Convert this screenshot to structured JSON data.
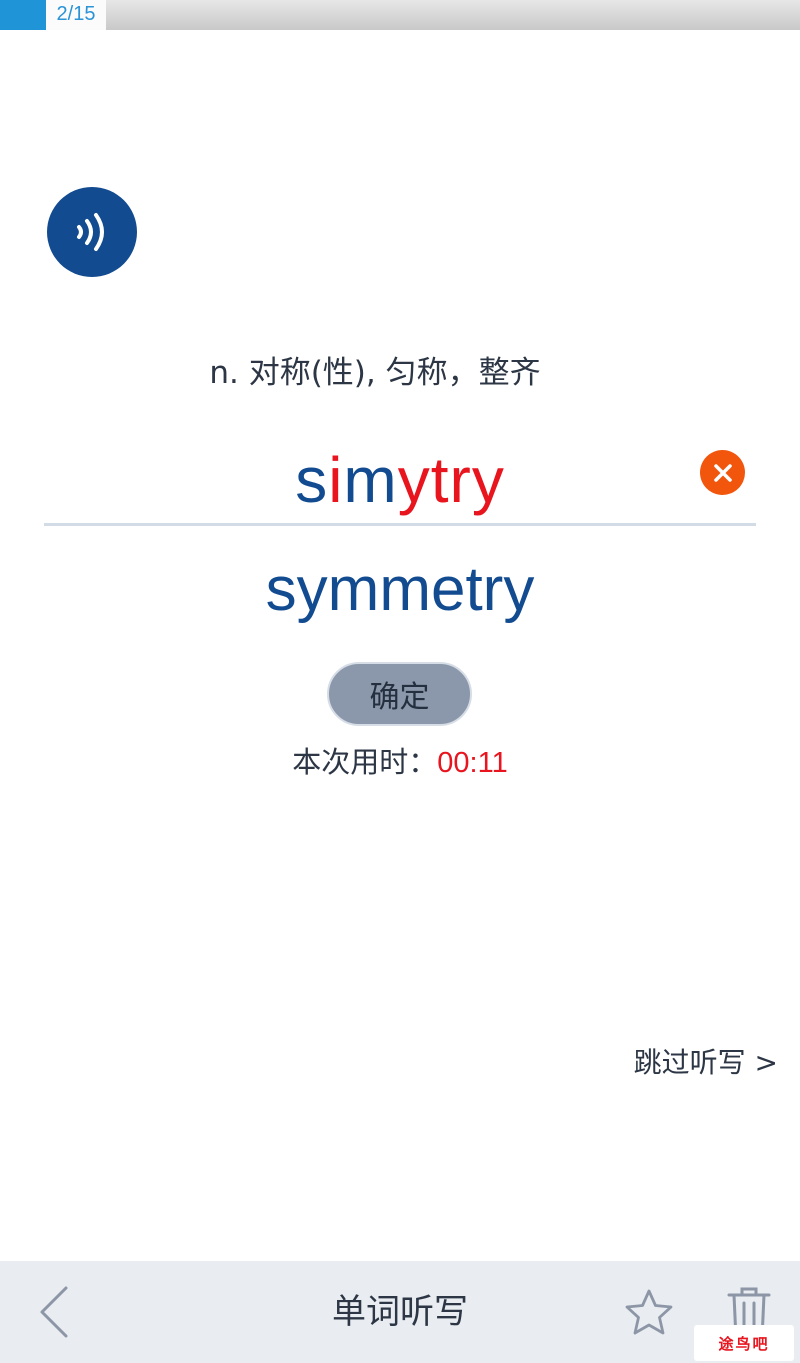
{
  "progress": {
    "label": "2/15",
    "current": 2,
    "total": 15
  },
  "definition": "n. 对称(性), 匀称，整齐",
  "answer": {
    "segments": [
      {
        "text": "s",
        "status": "correct"
      },
      {
        "text": "i",
        "status": "wrong"
      },
      {
        "text": "m",
        "status": "correct"
      },
      {
        "text": "ytry",
        "status": "wrong"
      }
    ]
  },
  "correct_word": "symmetry",
  "confirm_label": "确定",
  "timer": {
    "label": "本次用时：",
    "value": "00:11"
  },
  "skip_label": "跳过听写 >",
  "bottom_bar": {
    "title": "单词听写"
  },
  "watermark": "途鸟吧",
  "colors": {
    "primary": "#124b90",
    "error": "#e8141e",
    "clear": "#f2560d",
    "progress": "#1f95d8"
  }
}
